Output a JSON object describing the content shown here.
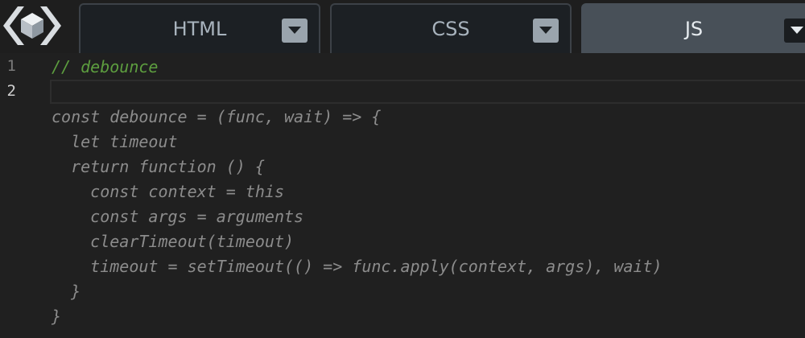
{
  "tabs": [
    {
      "label": "HTML",
      "active": false
    },
    {
      "label": "CSS",
      "active": false
    },
    {
      "label": "JS",
      "active": true
    }
  ],
  "editor": {
    "line_numbers": [
      "1",
      "2"
    ],
    "active_line": 2,
    "lines": [
      {
        "text": "// debounce",
        "kind": "comment"
      },
      {
        "text": "",
        "kind": "code"
      },
      {
        "text": "const debounce = (func, wait) => {",
        "kind": "code"
      },
      {
        "text": "  let timeout",
        "kind": "code"
      },
      {
        "text": "  return function () {",
        "kind": "code"
      },
      {
        "text": "    const context = this",
        "kind": "code"
      },
      {
        "text": "    const args = arguments",
        "kind": "code"
      },
      {
        "text": "    clearTimeout(timeout)",
        "kind": "code"
      },
      {
        "text": "    timeout = setTimeout(() => func.apply(context, args), wait)",
        "kind": "code"
      },
      {
        "text": "  }",
        "kind": "code"
      },
      {
        "text": "}",
        "kind": "code"
      }
    ]
  },
  "colors": {
    "comment": "#5d9e3f",
    "code": "#8c8c8c",
    "background": "#202020",
    "active_tab": "#485058"
  },
  "icons": {
    "logo": "codepen-cube-logo-icon",
    "dropdown": "chevron-down-icon"
  }
}
